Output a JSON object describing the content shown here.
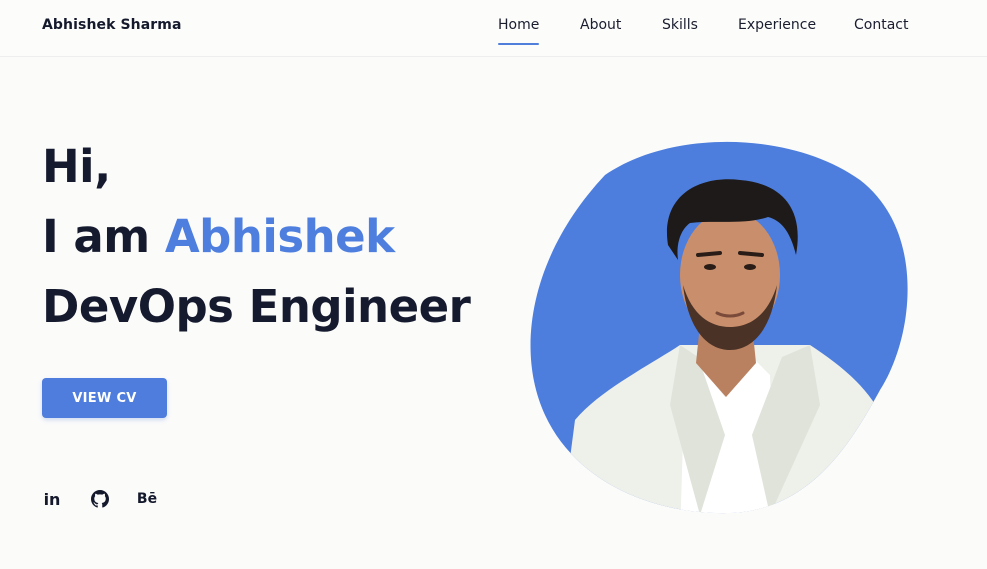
{
  "brand": "Abhishek Sharma",
  "nav": {
    "items": [
      {
        "label": "Home",
        "active": true
      },
      {
        "label": "About",
        "active": false
      },
      {
        "label": "Skills",
        "active": false
      },
      {
        "label": "Experience",
        "active": false
      },
      {
        "label": "Contact",
        "active": false
      }
    ]
  },
  "hero": {
    "greeting": "Hi,",
    "intro_prefix": "I am ",
    "name": "Abhishek",
    "role": "DevOps Engineer",
    "cv_button": "VIEW CV"
  },
  "social": {
    "linkedin": "in",
    "github_icon": "github-icon",
    "behance": "Bē"
  },
  "colors": {
    "accent": "#4e7fdf",
    "blob": "#4d7edd",
    "text": "#151a2e",
    "background": "#fbfbfa"
  }
}
